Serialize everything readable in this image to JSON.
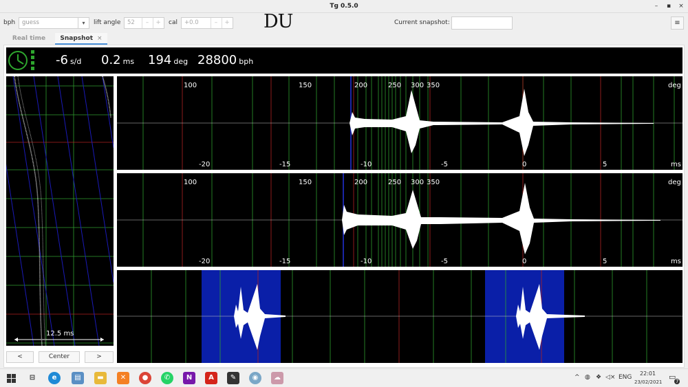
{
  "window": {
    "title": "Tg 0.5.0",
    "min": "–",
    "max": "▪",
    "close": "×"
  },
  "toolbar": {
    "bph_label": "bph",
    "bph_value": "guess",
    "lift_label": "lift angle",
    "lift_value": "52",
    "cal_label": "cal",
    "cal_value": "+0.0",
    "spin_minus": "–",
    "spin_plus": "+",
    "logo": "DU",
    "snapshot_label": "Current snapshot:",
    "snapshot_value": "",
    "menu_icon": "≡"
  },
  "tabs": [
    {
      "label": "Real time"
    },
    {
      "label": "Snapshot",
      "close": "×"
    }
  ],
  "status": {
    "rate": "-6",
    "rate_unit": "s/d",
    "beat_error": "0.2",
    "beat_error_unit": "ms",
    "amplitude": "194",
    "amplitude_unit": "deg",
    "bph": "28800",
    "bph_unit": "bph",
    "indicator_color": "#2ea62e"
  },
  "paper": {
    "scale_label": "12.5 ms",
    "prev": "<",
    "center": "Center",
    "next": ">"
  },
  "graphs": {
    "deg_unit": "deg",
    "ms_unit": "ms",
    "deg_ticks": [
      "100",
      "150",
      "200",
      "250",
      "300",
      "350"
    ],
    "ms_ticks": [
      "-20",
      "-15",
      "-10",
      "-5",
      "0",
      "5"
    ]
  },
  "taskbar": {
    "lang": "ENG",
    "time": "22:01",
    "date": "23/02/2021",
    "notif_count": "7",
    "icons": [
      "windows-start",
      "task-view",
      "edge",
      "file-explorer",
      "folder",
      "xampp",
      "chrome",
      "whatsapp",
      "onenote",
      "acrobat",
      "inkscape",
      "tg-app",
      "cloud-app"
    ]
  },
  "colors": {
    "accent": "#4a90d9",
    "plot_bg": "#000000",
    "wave": "#ffffff",
    "grid_green": "#2f9e2f",
    "grid_red": "#b22222",
    "highlight_blue": "#0a1fa8"
  }
}
